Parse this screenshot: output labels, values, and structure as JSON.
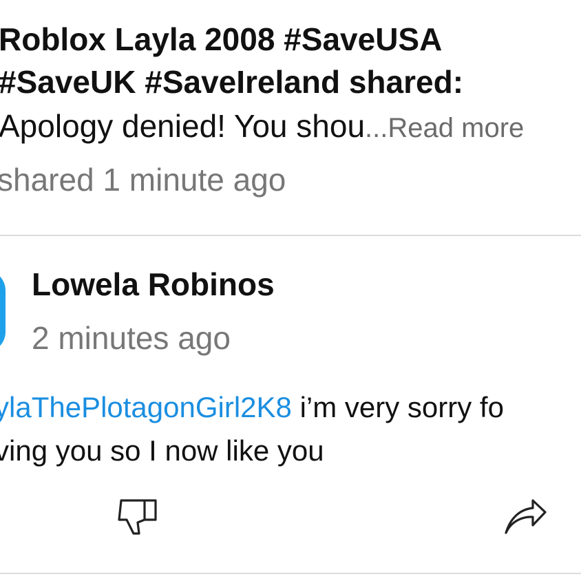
{
  "shared_post": {
    "title_line1": "Roblox Layla 2008 #SaveUSA",
    "title_line2": "#SaveUK #SaveIreland shared:",
    "body_preview": "Apology denied! You shou",
    "read_more": "...Read more",
    "timestamp": "shared 1 minute ago"
  },
  "comment": {
    "author": "Lowela Robinos",
    "timestamp": "2 minutes ago",
    "mention": "ylaThePlotagonGirl2K8",
    "text_line1_rest": " i’m very sorry fo",
    "text_line2": "ving you so I now like you"
  },
  "actions": {
    "dislike_icon": "thumbs-down-icon",
    "share_icon": "share-arrow-icon"
  },
  "colors": {
    "mention": "#1a8ee1",
    "avatar": "#1ea1ea",
    "muted_text": "#777777",
    "divider": "#dcdcdc"
  }
}
